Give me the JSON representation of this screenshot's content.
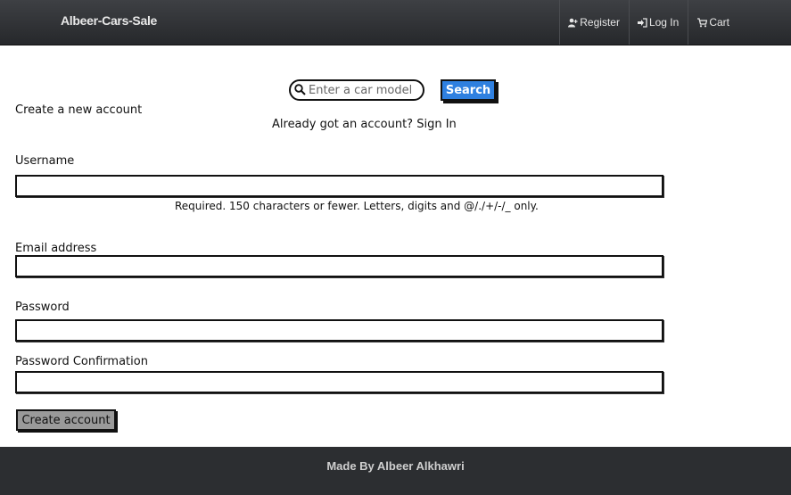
{
  "navbar": {
    "brand": "Albeer-Cars-Sale",
    "items": [
      {
        "label": "Register",
        "icon": "add-user-icon"
      },
      {
        "label": "Log In",
        "icon": "log-in-icon"
      },
      {
        "label": "Cart",
        "icon": "cart-icon"
      }
    ]
  },
  "search": {
    "placeholder": "Enter a car model",
    "button_label": "Search",
    "accent_color": "#2f80e0"
  },
  "form": {
    "heading": "Create a new account",
    "signin_prompt": "Already got an account?",
    "signin_link": "Sign In",
    "username_label": "Username",
    "username_help": "Required. 150 characters or fewer. Letters, digits and @/./+/-/_ only.",
    "email_label": "Email address",
    "password_label": "Password",
    "password_confirm_label": "Password Confirmation",
    "submit_label": "Create account"
  },
  "footer": {
    "text": "Made By Albeer Alkhawri"
  }
}
